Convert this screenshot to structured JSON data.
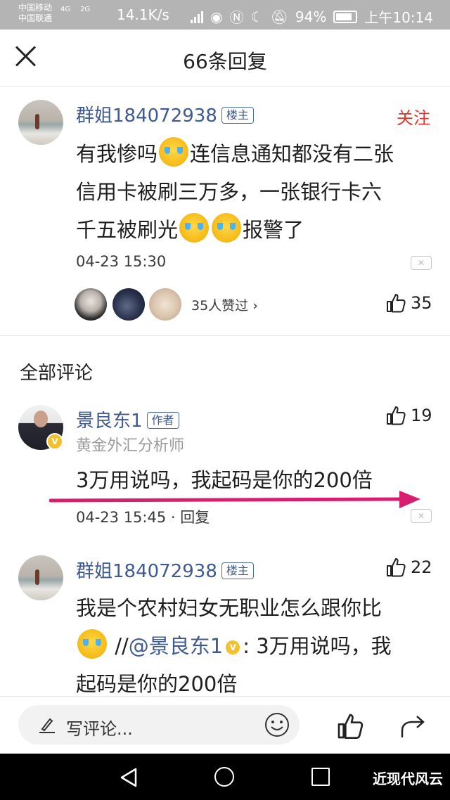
{
  "status_bar": {
    "carrier1": "中国移动",
    "carrier2": "中国联通",
    "net1": "4G",
    "net2": "2G",
    "speed": "14.1K/s",
    "battery": "94%",
    "time": "上午10:14"
  },
  "header": {
    "title": "66条回复"
  },
  "main_post": {
    "username": "群姐184072938",
    "tag": "楼主",
    "follow_label": "关注",
    "line1_a": "有我惨吗",
    "line1_b": "连信息通知都没有二张",
    "line2": "信用卡被刷三万多，一张银行卡六",
    "line3_a": "千五被刷光",
    "line3_b": "报警了",
    "time": "04-23 15:30",
    "likers_text": "35人赞过 ›",
    "like_count": "35"
  },
  "section_title": "全部评论",
  "comments": [
    {
      "username": "景良东1",
      "tag": "作者",
      "subtitle": "黄金外汇分析师",
      "text": "3万用说吗，我起码是你的200倍",
      "meta": "04-23 15:45 · 回复",
      "like_count": "19"
    },
    {
      "username": "群姐184072938",
      "tag": "楼主",
      "line1": "我是个农村妇女无职业怎么跟你比",
      "line2_a": "//",
      "line2_mention": "@景良东1",
      "line2_b": ": 3万用说吗，我",
      "line3": "起码是你的200倍",
      "like_count": "22"
    }
  ],
  "bottom_bar": {
    "placeholder": "写评论..."
  },
  "watermark": "近现代风云",
  "colors": {
    "username": "#3e5a92",
    "follow": "#e0352b",
    "arrow": "#d81e6e"
  }
}
